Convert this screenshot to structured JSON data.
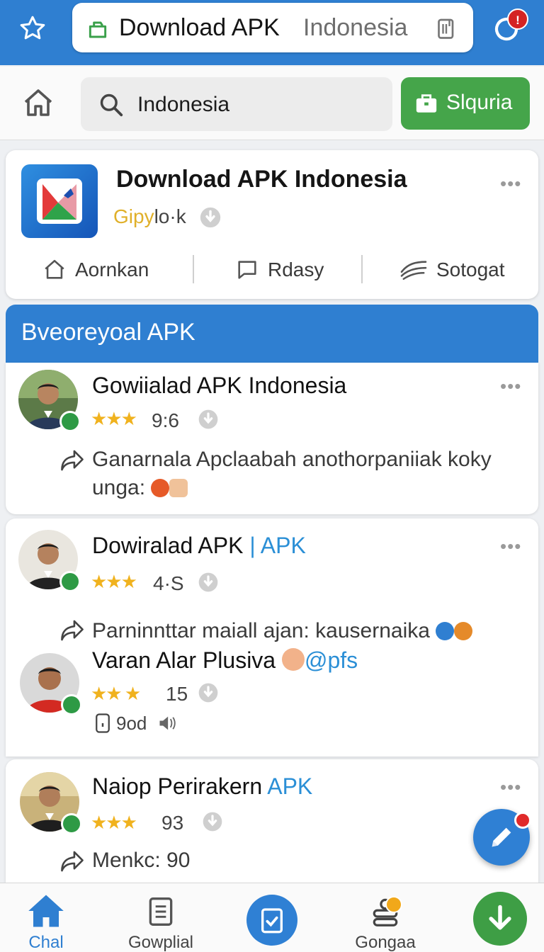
{
  "browser": {
    "url_bold": "Download APK",
    "url_domain": "Indonesia",
    "notification_count": "!"
  },
  "search": {
    "query": "Indonesia",
    "store_button_label": "Slquria"
  },
  "app": {
    "title": "Download APK Indonesia",
    "developer_part1": "Gipy",
    "developer_part2": "lo·k",
    "actions": [
      "Aornkan",
      "Rdasy",
      "Sotogat"
    ]
  },
  "section": {
    "title": "Bveoreyoal APK"
  },
  "posts": [
    {
      "name": "Gowiialad APK Indonesia",
      "rating": "9:6",
      "text_line1": "Ganarnala Apclaabah anothorpaniiak koky",
      "text_line2": "unga:"
    },
    {
      "name": "Dowiralad APK",
      "name_tag": "APK",
      "rating": "4·S",
      "text_line1": "Parninnttar maiall ajan: kausernaika"
    },
    {
      "name": "Varan Alar Plusiva",
      "handle": "@pfs",
      "rating": "15",
      "meta": "9od"
    },
    {
      "name": "Naiop Perirakern",
      "name_tag": "APK",
      "rating": "93",
      "text_line1": "Menkc: 90"
    }
  ],
  "nav": {
    "items": [
      "Chal",
      "Gowplial",
      "Gongaa"
    ]
  },
  "colors": {
    "primary": "#2f7fd1",
    "green": "#45a54a",
    "star": "#f0b21e",
    "link": "#2b8fd6"
  },
  "icons": [
    "star-icon",
    "lock-icon",
    "clipboard-icon",
    "refresh-icon",
    "home-icon",
    "search-icon",
    "briefcase-icon",
    "download-circle-icon",
    "chat-icon",
    "share-arrow-icon",
    "pencil-icon",
    "document-icon",
    "checklist-icon",
    "stack-icon",
    "download-arrow-icon"
  ]
}
